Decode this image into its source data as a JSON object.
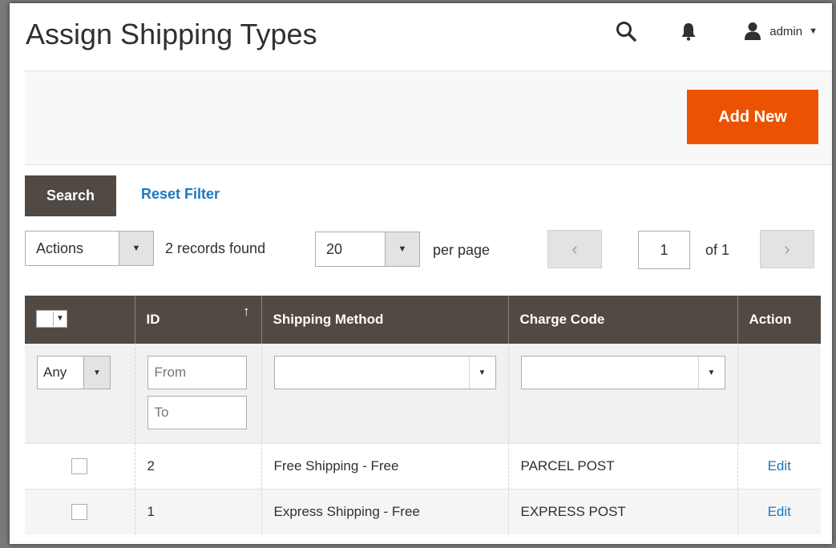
{
  "header": {
    "title": "Assign Shipping Types",
    "user_name": "admin"
  },
  "action_bar": {
    "add_new_label": "Add New"
  },
  "filters": {
    "search_label": "Search",
    "reset_label": "Reset Filter"
  },
  "toolbar": {
    "actions_label": "Actions",
    "records_found": "2 records found",
    "per_page_value": "20",
    "per_page_label": "per page",
    "current_page": "1",
    "total_pages": "of 1",
    "prev_symbol": "‹",
    "next_symbol": "›"
  },
  "grid": {
    "columns": [
      "ID",
      "Shipping Method",
      "Charge Code",
      "Action"
    ],
    "sort_indicator": "↑",
    "filter_any": "Any",
    "filter_from_placeholder": "From",
    "filter_to_placeholder": "To",
    "rows": [
      {
        "id": "2",
        "method": "Free Shipping - Free",
        "charge_code": "PARCEL POST",
        "action": "Edit"
      },
      {
        "id": "1",
        "method": "Express Shipping - Free",
        "charge_code": "EXPRESS POST",
        "action": "Edit"
      }
    ]
  },
  "colors": {
    "accent": "#eb5202",
    "header_bg": "#514943",
    "link": "#1979c3"
  }
}
